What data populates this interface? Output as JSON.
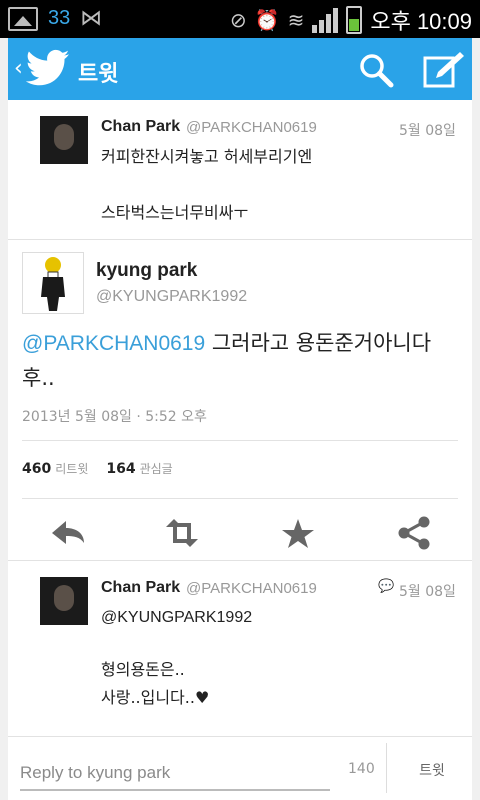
{
  "statusbar": {
    "notification_count": "33",
    "carrier_time_prefix": "오후",
    "time": "10:09"
  },
  "header": {
    "title": "트윗",
    "accent": "#2aa3e8"
  },
  "reply_tweet": {
    "name": "Chan Park",
    "handle": "@PARKCHAN0619",
    "date": "5월 08일",
    "line1": "커피한잔시켜놓고 허세부리기엔",
    "line2": "스타벅스는너무비싸ㅜ"
  },
  "main_tweet": {
    "name": "kyung park",
    "handle": "@KYUNGPARK1992",
    "mention": "@PARKCHAN0619",
    "text": " 그러라고 용돈준거아니다후..",
    "timestamp": "2013년 5월 08일 · 5:52 오후",
    "retweets": "460",
    "retweets_label": "리트윗",
    "favorites": "164",
    "favorites_label": "관심글"
  },
  "conversation_tweet": {
    "name": "Chan Park",
    "handle": "@PARKCHAN0619",
    "date": "5월 08일",
    "line1": "@KYUNGPARK1992",
    "line2": "형의용돈은..",
    "line3": "사랑..입니다..♥"
  },
  "reply_bar": {
    "placeholder": "Reply to kyung park",
    "char_count": "140",
    "tweet_label": "트윗"
  }
}
